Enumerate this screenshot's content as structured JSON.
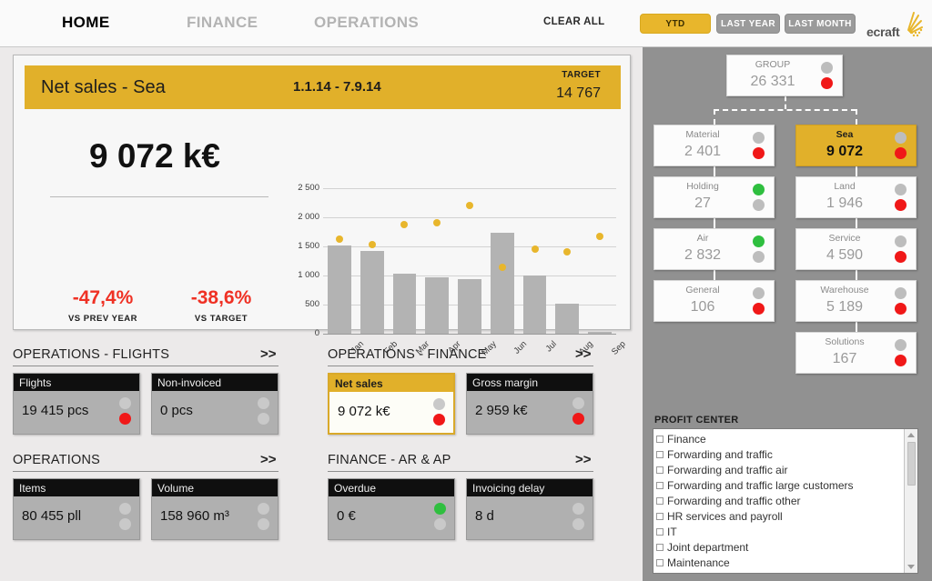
{
  "topbar": {
    "nav": [
      {
        "label": "HOME",
        "active": true
      },
      {
        "label": "FINANCE",
        "active": false
      },
      {
        "label": "OPERATIONS",
        "active": false
      }
    ],
    "clear_all": "CLEAR ALL",
    "periods": [
      {
        "label": "YTD",
        "selected": true
      },
      {
        "label": "LAST YEAR",
        "selected": false
      },
      {
        "label": "LAST MONTH",
        "selected": false
      }
    ],
    "logo_text": "ecraft",
    "accent_color": "#e1b02a"
  },
  "bigcard": {
    "title": "Net sales - Sea",
    "period": "1.1.14 - 7.9.14",
    "target_label": "TARGET",
    "target_value": "14 767",
    "value": "9 072 k€",
    "deltas": [
      {
        "value": "-47,4%",
        "label": "VS PREV YEAR",
        "color": "#ef3124"
      },
      {
        "value": "-38,6%",
        "label": "VS TARGET",
        "color": "#ef3124"
      }
    ]
  },
  "chart_data": {
    "type": "bar",
    "title": "",
    "xlabel": "",
    "ylabel": "",
    "categories": [
      "Jan",
      "Feb",
      "Mar",
      "Apr",
      "May",
      "Jun",
      "Jul",
      "Aug",
      "Sep"
    ],
    "yticks": [
      "0",
      "500",
      "1 000",
      "1 500",
      "2 000",
      "2 500"
    ],
    "ylim": [
      0,
      2500
    ],
    "grid": true,
    "legend": "none",
    "series": [
      {
        "name": "Net sales",
        "kind": "bar",
        "color": "#b3b3b3",
        "values": [
          1510,
          1420,
          1030,
          965,
          930,
          1740,
          1000,
          515,
          25
        ]
      },
      {
        "name": "Target",
        "kind": "scatter",
        "color": "#e8b62c",
        "values": [
          1630,
          1525,
          1870,
          1900,
          2205,
          1135,
          1450,
          1400,
          1670
        ]
      }
    ]
  },
  "sections": [
    {
      "title": "OPERATIONS - FLIGHTS",
      "more": ">>",
      "tiles": [
        {
          "name": "Flights",
          "value": "19 415 pcs",
          "selected": false,
          "lamp_top": "gray",
          "lamp_bottom": "red"
        },
        {
          "name": "Non-invoiced",
          "value": "0 pcs",
          "selected": false,
          "lamp_top": "gray",
          "lamp_bottom": "gray"
        }
      ]
    },
    {
      "title": "OPERATIONS",
      "more": ">>",
      "tiles": [
        {
          "name": "Items",
          "value": "80 455 pll",
          "selected": false,
          "lamp_top": "gray",
          "lamp_bottom": "gray"
        },
        {
          "name": "Volume",
          "value": "158 960 m³",
          "selected": false,
          "lamp_top": "gray",
          "lamp_bottom": "gray"
        }
      ]
    },
    {
      "title": "OPERATIONS - FINANCE",
      "more": ">>",
      "tiles": [
        {
          "name": "Net sales",
          "value": "9 072 k€",
          "selected": true,
          "lamp_top": "gray",
          "lamp_bottom": "red"
        },
        {
          "name": "Gross margin",
          "value": "2 959 k€",
          "selected": false,
          "lamp_top": "gray",
          "lamp_bottom": "red"
        }
      ]
    },
    {
      "title": "FINANCE - AR & AP",
      "more": ">>",
      "tiles": [
        {
          "name": "Overdue",
          "value": "0 €",
          "selected": false,
          "lamp_top": "green",
          "lamp_bottom": "gray"
        },
        {
          "name": "Invoicing delay",
          "value": "8 d",
          "selected": false,
          "lamp_top": "gray",
          "lamp_bottom": "gray"
        }
      ]
    }
  ],
  "tree": {
    "nodes": [
      {
        "id": "group",
        "name": "GROUP",
        "value": "26 331",
        "selected": false,
        "lamp_top": "gray",
        "lamp_bottom": "red"
      },
      {
        "id": "material",
        "name": "Material",
        "value": "2 401",
        "selected": false,
        "lamp_top": "gray",
        "lamp_bottom": "red"
      },
      {
        "id": "sea",
        "name": "Sea",
        "value": "9 072",
        "selected": true,
        "lamp_top": "gray",
        "lamp_bottom": "red"
      },
      {
        "id": "holding",
        "name": "Holding",
        "value": "27",
        "selected": false,
        "lamp_top": "green",
        "lamp_bottom": "gray"
      },
      {
        "id": "land",
        "name": "Land",
        "value": "1 946",
        "selected": false,
        "lamp_top": "gray",
        "lamp_bottom": "red"
      },
      {
        "id": "air",
        "name": "Air",
        "value": "2 832",
        "selected": false,
        "lamp_top": "green",
        "lamp_bottom": "gray"
      },
      {
        "id": "service",
        "name": "Service",
        "value": "4 590",
        "selected": false,
        "lamp_top": "gray",
        "lamp_bottom": "red"
      },
      {
        "id": "general",
        "name": "General",
        "value": "106",
        "selected": false,
        "lamp_top": "gray",
        "lamp_bottom": "red"
      },
      {
        "id": "warehouse",
        "name": "Warehouse",
        "value": "5 189",
        "selected": false,
        "lamp_top": "gray",
        "lamp_bottom": "red"
      },
      {
        "id": "solutions",
        "name": "Solutions",
        "value": "167",
        "selected": false,
        "lamp_top": "gray",
        "lamp_bottom": "red"
      }
    ]
  },
  "profit_center": {
    "title": "PROFIT CENTER",
    "items": [
      "Finance",
      "Forwarding and traffic",
      "Forwarding and traffic air",
      "Forwarding and traffic large customers",
      "Forwarding and traffic other",
      "HR services and payroll",
      "IT",
      "Joint department",
      "Maintenance"
    ]
  }
}
